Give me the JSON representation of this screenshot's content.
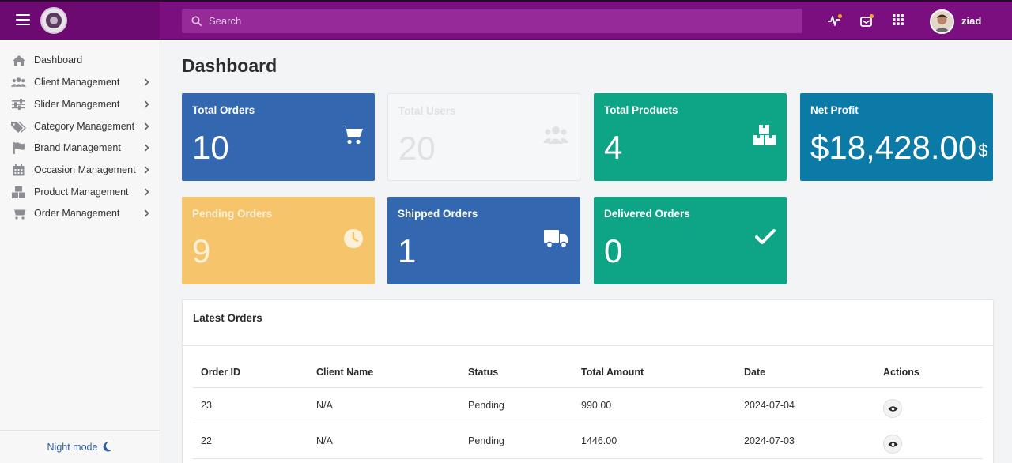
{
  "header": {
    "search_placeholder": "Search",
    "username": "ziad",
    "icons": [
      "hamburger-icon",
      "search-icon",
      "activity-icon",
      "inbox-icon",
      "apps-grid-icon"
    ]
  },
  "sidebar": {
    "items": [
      {
        "label": "Dashboard",
        "icon": "home-icon"
      },
      {
        "label": "Client Management",
        "icon": "users-icon"
      },
      {
        "label": "Slider Management",
        "icon": "sliders-icon"
      },
      {
        "label": "Category Management",
        "icon": "tags-icon"
      },
      {
        "label": "Brand Management",
        "icon": "flag-icon"
      },
      {
        "label": "Occasion Management",
        "icon": "calendar-icon"
      },
      {
        "label": "Product Management",
        "icon": "boxes-icon"
      },
      {
        "label": "Order Management",
        "icon": "cart-icon"
      }
    ],
    "night_mode": "Night mode"
  },
  "page": {
    "title": "Dashboard"
  },
  "cards": [
    {
      "title": "Total Orders",
      "value": "10",
      "color": "#3367b0",
      "icon": "cart-icon"
    },
    {
      "title": "Total Users",
      "value": "20",
      "color": "#f6f7f9",
      "icon": "users-icon"
    },
    {
      "title": "Total Products",
      "value": "4",
      "color": "#0ea586",
      "icon": "boxes-icon"
    },
    {
      "title": "Net Profit",
      "value": "$18,428.00",
      "currency": "$",
      "color": "#0c7aa6",
      "icon": "dollar-icon"
    },
    {
      "title": "Pending Orders",
      "value": "9",
      "color": "#f6c46a",
      "icon": "clock-icon"
    },
    {
      "title": "Shipped Orders",
      "value": "1",
      "color": "#3367b0",
      "icon": "truck-icon"
    },
    {
      "title": "Delivered Orders",
      "value": "0",
      "color": "#0ea586",
      "icon": "check-icon"
    }
  ],
  "latest_orders": {
    "title": "Latest Orders",
    "columns": [
      "Order ID",
      "Client Name",
      "Status",
      "Total Amount",
      "Date",
      "Actions"
    ],
    "rows": [
      {
        "id": "23",
        "client": "N/A",
        "status": "Pending",
        "amount": "990.00",
        "date": "2024-07-04"
      },
      {
        "id": "22",
        "client": "N/A",
        "status": "Pending",
        "amount": "1446.00",
        "date": "2024-07-03"
      }
    ]
  }
}
